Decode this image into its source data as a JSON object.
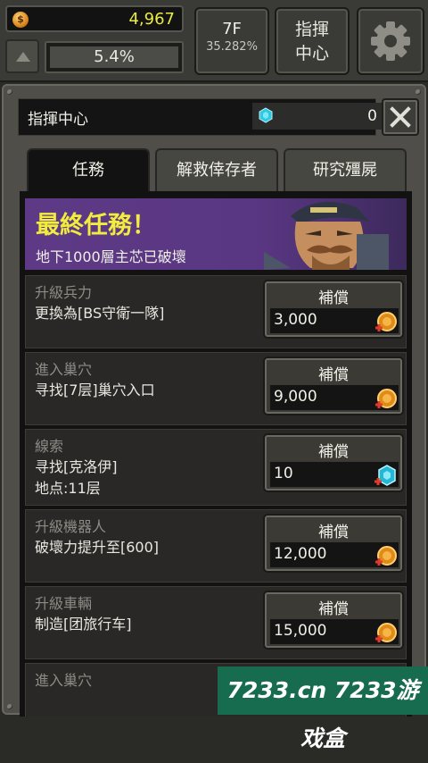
{
  "hud": {
    "gold": "4,967",
    "progress": "5.4%",
    "floor": "7F",
    "floor_percent": "35.282%",
    "command_center_line1": "指揮",
    "command_center_line2": "中心",
    "icons": {
      "coin": "coin-icon",
      "up": "up-arrow-icon",
      "settings": "gear-icon"
    }
  },
  "panel": {
    "title": "指揮中心",
    "gems": "0",
    "tabs": [
      "任務",
      "解救倖存者",
      "研究殭屍"
    ],
    "active_tab": 0
  },
  "banner": {
    "title": "最終任務！",
    "subtitle": "地下1000層主芯已破壞"
  },
  "missions": [
    {
      "category": "升級兵力",
      "desc": [
        "更換為[BS守衛一隊]"
      ],
      "reward_label": "補償",
      "reward": "3,000",
      "reward_type": "coin"
    },
    {
      "category": "進入巢穴",
      "desc": [
        "寻找[7层]巢穴入口"
      ],
      "reward_label": "補償",
      "reward": "9,000",
      "reward_type": "coin"
    },
    {
      "category": "線索",
      "desc": [
        "寻找[克洛伊]",
        "地点:11层"
      ],
      "reward_label": "補償",
      "reward": "10",
      "reward_type": "gem"
    },
    {
      "category": "升級機器人",
      "desc": [
        "破壞力提升至[600]"
      ],
      "reward_label": "補償",
      "reward": "12,000",
      "reward_type": "coin"
    },
    {
      "category": "升級車輛",
      "desc": [
        "制造[团旅行车]"
      ],
      "reward_label": "補償",
      "reward": "15,000",
      "reward_type": "coin"
    },
    {
      "category": "進入巢穴",
      "desc": [],
      "reward_label": "",
      "reward": "",
      "reward_type": ""
    }
  ],
  "watermark": "7233.cn 7233游戏盒",
  "colors": {
    "gold_text": "#e9ea43",
    "banner_title": "#f2ec3c",
    "banner_bg": "#5e3a86"
  }
}
